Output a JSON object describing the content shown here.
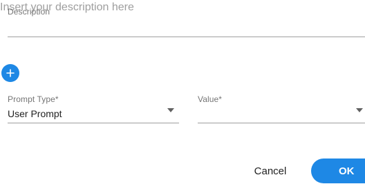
{
  "description": {
    "label": "Description",
    "placeholder": "Insert your description here",
    "value": ""
  },
  "add_button": {
    "icon": "plus-icon"
  },
  "prompt_type": {
    "label": "Prompt Type*",
    "selected": "User Prompt",
    "icon": "caret-down-icon"
  },
  "value_field": {
    "label": "Value*",
    "selected": "",
    "icon": "caret-down-icon"
  },
  "actions": {
    "cancel_label": "Cancel",
    "ok_label": "OK"
  },
  "colors": {
    "accent": "#1e88e5",
    "label": "#757575",
    "placeholder": "#9e9e9e",
    "underline": "#9e9e9e"
  }
}
